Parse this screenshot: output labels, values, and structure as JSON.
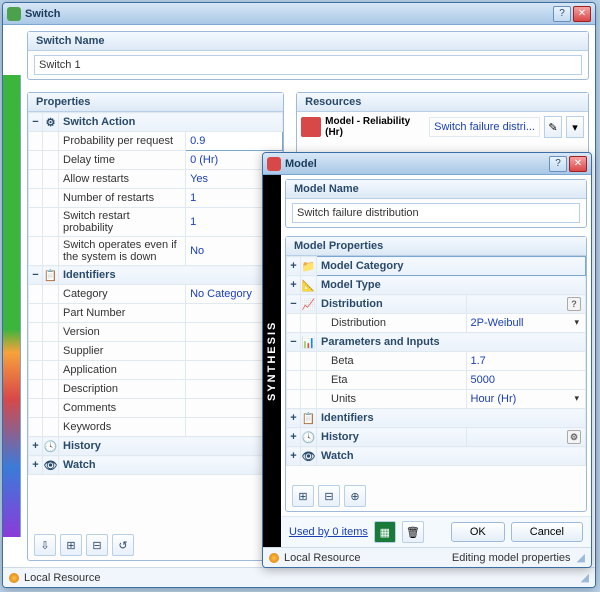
{
  "switchWindow": {
    "title": "Switch",
    "nameSection": {
      "header": "Switch Name",
      "value": "Switch 1"
    },
    "propertiesHeader": "Properties",
    "resourcesHeader": "Resources",
    "groups": {
      "switchAction": {
        "label": "Switch Action",
        "rows": [
          {
            "name": "Probability per request",
            "value": "0.9",
            "editing": true
          },
          {
            "name": "Delay time",
            "value": "0 (Hr)"
          },
          {
            "name": "Allow restarts",
            "value": "Yes"
          },
          {
            "name": "Number of restarts",
            "value": "1"
          },
          {
            "name": "Switch restart probability",
            "value": "1"
          },
          {
            "name": "Switch operates even if the system is down",
            "value": "No"
          }
        ]
      },
      "identifiers": {
        "label": "Identifiers",
        "rows": [
          {
            "name": "Category",
            "value": "No Category"
          },
          {
            "name": "Part Number",
            "value": ""
          },
          {
            "name": "Version",
            "value": ""
          },
          {
            "name": "Supplier",
            "value": ""
          },
          {
            "name": "Application",
            "value": ""
          },
          {
            "name": "Description",
            "value": ""
          },
          {
            "name": "Comments",
            "value": ""
          },
          {
            "name": "Keywords",
            "value": ""
          }
        ]
      },
      "history": {
        "label": "History"
      },
      "watch": {
        "label": "Watch"
      }
    },
    "resource": {
      "label": "Model - Reliability (Hr)",
      "value": "Switch failure distri..."
    },
    "status": "Local Resource"
  },
  "modelWindow": {
    "title": "Model",
    "brand": "SYNTHESIS",
    "nameSection": {
      "header": "Model Name",
      "value": "Switch failure distribution"
    },
    "propertiesHeader": "Model Properties",
    "groups": {
      "category": {
        "label": "Model Category"
      },
      "type": {
        "label": "Model Type"
      },
      "distribution": {
        "label": "Distribution",
        "rows": [
          {
            "name": "Distribution",
            "value": "2P-Weibull",
            "dropdown": true
          }
        ]
      },
      "params": {
        "label": "Parameters and Inputs",
        "rows": [
          {
            "name": "Beta",
            "value": "1.7"
          },
          {
            "name": "Eta",
            "value": "5000"
          },
          {
            "name": "Units",
            "value": "Hour (Hr)",
            "dropdown": true
          }
        ]
      },
      "identifiers": {
        "label": "Identifiers"
      },
      "history": {
        "label": "History"
      },
      "watch": {
        "label": "Watch"
      }
    },
    "footer": {
      "usedBy": "Used by 0 items",
      "ok": "OK",
      "cancel": "Cancel"
    },
    "status": {
      "left": "Local Resource",
      "right": "Editing model properties"
    }
  }
}
